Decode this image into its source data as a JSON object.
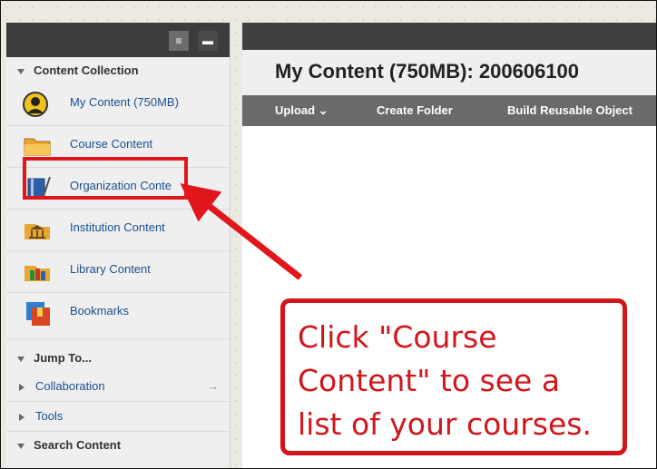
{
  "sidebar": {
    "sections": {
      "content_collection": "Content Collection",
      "jump_to": "Jump To...",
      "search_content": "Search Content"
    },
    "items": [
      {
        "label": "My Content (750MB)",
        "icon": "user-avatar-icon"
      },
      {
        "label": "Course Content",
        "icon": "folder-icon"
      },
      {
        "label": "Organization Conte",
        "icon": "book-icon"
      },
      {
        "label": "Institution Content",
        "icon": "institution-icon"
      },
      {
        "label": "Library Content",
        "icon": "library-icon"
      },
      {
        "label": "Bookmarks",
        "icon": "bookmarks-icon"
      }
    ],
    "jump": [
      {
        "label": "Collaboration",
        "arrow": "→"
      },
      {
        "label": "Tools"
      }
    ],
    "view_toggles": {
      "list": "≡",
      "folder": "▬"
    }
  },
  "main": {
    "title": "My Content (750MB): 200606100",
    "toolbar": {
      "upload": "Upload ⌄",
      "create_folder": "Create Folder",
      "build_reusable": "Build Reusable Object"
    }
  },
  "callout": {
    "text": "Click \"Course\nContent\" to see a\nlist of your courses."
  },
  "colors": {
    "accent_red": "#d0161b",
    "link_blue": "#1a4f8f"
  }
}
